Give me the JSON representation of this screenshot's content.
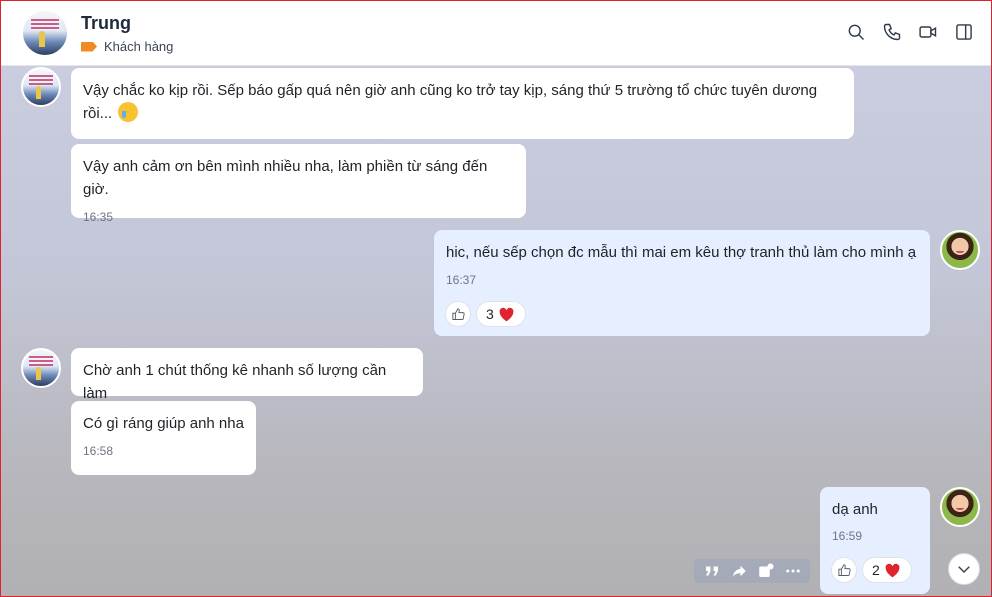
{
  "header": {
    "contact_name": "Trung",
    "tag_label": "Khách hàng",
    "tag_color": "#f08a24",
    "icons": [
      "search-icon",
      "phone-icon",
      "video-call-icon",
      "sidebar-toggle-icon"
    ]
  },
  "messages": [
    {
      "direction": "in",
      "text": "Vậy chắc ko kịp rồi. Sếp báo gấp quá nên giờ anh cũng ko trở tay kịp, sáng thứ 5 trường tổ chức tuyên dương rồi...",
      "emoji": "crying-face-emoji"
    },
    {
      "direction": "in",
      "text": "Vậy anh cảm ơn bên mình nhiều nha, làm phiền từ sáng đến giờ.",
      "time": "16:35"
    },
    {
      "direction": "out",
      "text": "hic, nếu sếp chọn đc mẫu thì mai em kêu thợ tranh thủ làm cho mình ạ",
      "time": "16:37",
      "reaction_count": "3"
    },
    {
      "direction": "in",
      "text": "Chờ anh 1 chút thống kê nhanh số lượng cần làm"
    },
    {
      "direction": "in",
      "text": "Có gì ráng giúp anh nha",
      "time": "16:58"
    },
    {
      "direction": "out",
      "text": "dạ anh",
      "time": "16:59",
      "reaction_count": "2"
    }
  ],
  "colors": {
    "incoming_bubble": "#ffffff",
    "outgoing_bubble": "#e5efff",
    "heart": "#e0242f"
  }
}
